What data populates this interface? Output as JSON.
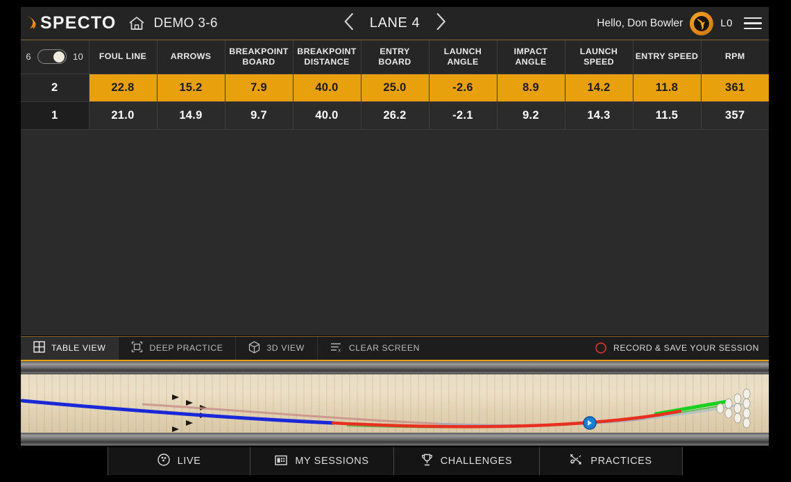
{
  "header": {
    "brand": "SPECTO",
    "brand_mark_icon": "specto-swoosh-icon",
    "home_icon": "home-icon",
    "demo_title": "DEMO 3-6",
    "prev_icon": "chevron-left-icon",
    "next_icon": "chevron-right-icon",
    "lane_label": "LANE 4",
    "greeting": "Hello, Don Bowler",
    "avatar_icon": "bowler-avatar-icon",
    "level": "L0",
    "menu_icon": "hamburger-menu-icon"
  },
  "table": {
    "toggle": {
      "left_label": "6",
      "right_label": "10",
      "state": "right"
    },
    "columns": [
      "FOUL LINE",
      "ARROWS",
      "BREAKPOINT BOARD",
      "BREAKPOINT DISTANCE",
      "ENTRY BOARD",
      "LAUNCH ANGLE",
      "IMPACT ANGLE",
      "LAUNCH SPEED",
      "ENTRY SPEED",
      "RPM"
    ],
    "rows": [
      {
        "index": "2",
        "highlighted": true,
        "values": [
          "22.8",
          "15.2",
          "7.9",
          "40.0",
          "25.0",
          "-2.6",
          "8.9",
          "14.2",
          "11.8",
          "361"
        ]
      },
      {
        "index": "1",
        "highlighted": false,
        "values": [
          "21.0",
          "14.9",
          "9.7",
          "40.0",
          "26.2",
          "-2.1",
          "9.2",
          "14.3",
          "11.5",
          "357"
        ]
      }
    ]
  },
  "view_bar": {
    "items": [
      {
        "label": "TABLE VIEW",
        "icon": "grid-table-icon",
        "active": true
      },
      {
        "label": "DEEP PRACTICE",
        "icon": "crop-frame-icon",
        "active": false
      },
      {
        "label": "3D  VIEW",
        "icon": "cube-3d-icon",
        "active": false
      },
      {
        "label": "CLEAR SCREEN",
        "icon": "clear-lines-icon",
        "active": false
      }
    ],
    "record_label": "RECORD & SAVE YOUR SESSION",
    "record_icon": "record-circle-icon"
  },
  "lane": {
    "ball_marker_icon": "ball-position-icon",
    "pins_icon": "pin-rack-icon",
    "arrows_icon": "lane-arrow-icon",
    "trajectories": [
      {
        "name": "shot-2-trajectory",
        "color": "#e83020"
      },
      {
        "name": "shot-1-trajectory",
        "color": "#1a28d8"
      },
      {
        "name": "shot-2-entry-segment",
        "color": "#18d020"
      },
      {
        "name": "shot-1-faded-trail",
        "color": "#8fb4d8"
      }
    ]
  },
  "bottom_nav": {
    "items": [
      {
        "label": "LIVE",
        "icon": "live-ball-icon"
      },
      {
        "label": "MY SESSIONS",
        "icon": "sessions-folder-icon"
      },
      {
        "label": "CHALLENGES",
        "icon": "trophy-icon"
      },
      {
        "label": "PRACTICES",
        "icon": "practice-plan-icon"
      }
    ]
  },
  "colors": {
    "accent": "#e8a00c",
    "panel": "#2b2b2b",
    "header": "#242424",
    "record": "#c22f2f"
  }
}
